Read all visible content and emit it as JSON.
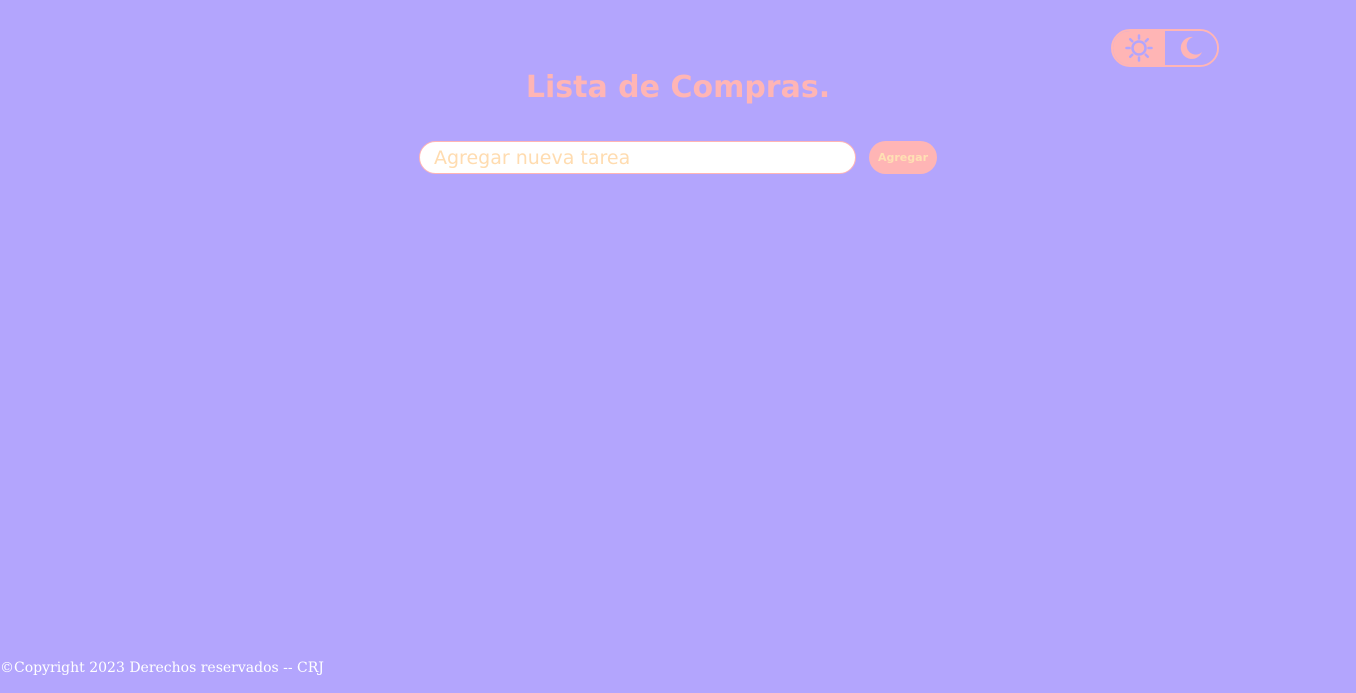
{
  "theme_toggle": {
    "light_icon": "sun-icon",
    "dark_icon": "moon-icon"
  },
  "header": {
    "title": "Lista de Compras."
  },
  "task_form": {
    "input_value": "",
    "input_placeholder": "Agregar nueva tarea",
    "add_label": "Agregar"
  },
  "footer": {
    "copyright": "©Copyright 2023 Derechos reservados -- CRJ"
  },
  "colors": {
    "background": "#b3a5fd",
    "accent": "#ffb5b5",
    "button_text": "#ffe0b3",
    "placeholder": "#ffdcb0",
    "footer_text": "#ffffff"
  }
}
